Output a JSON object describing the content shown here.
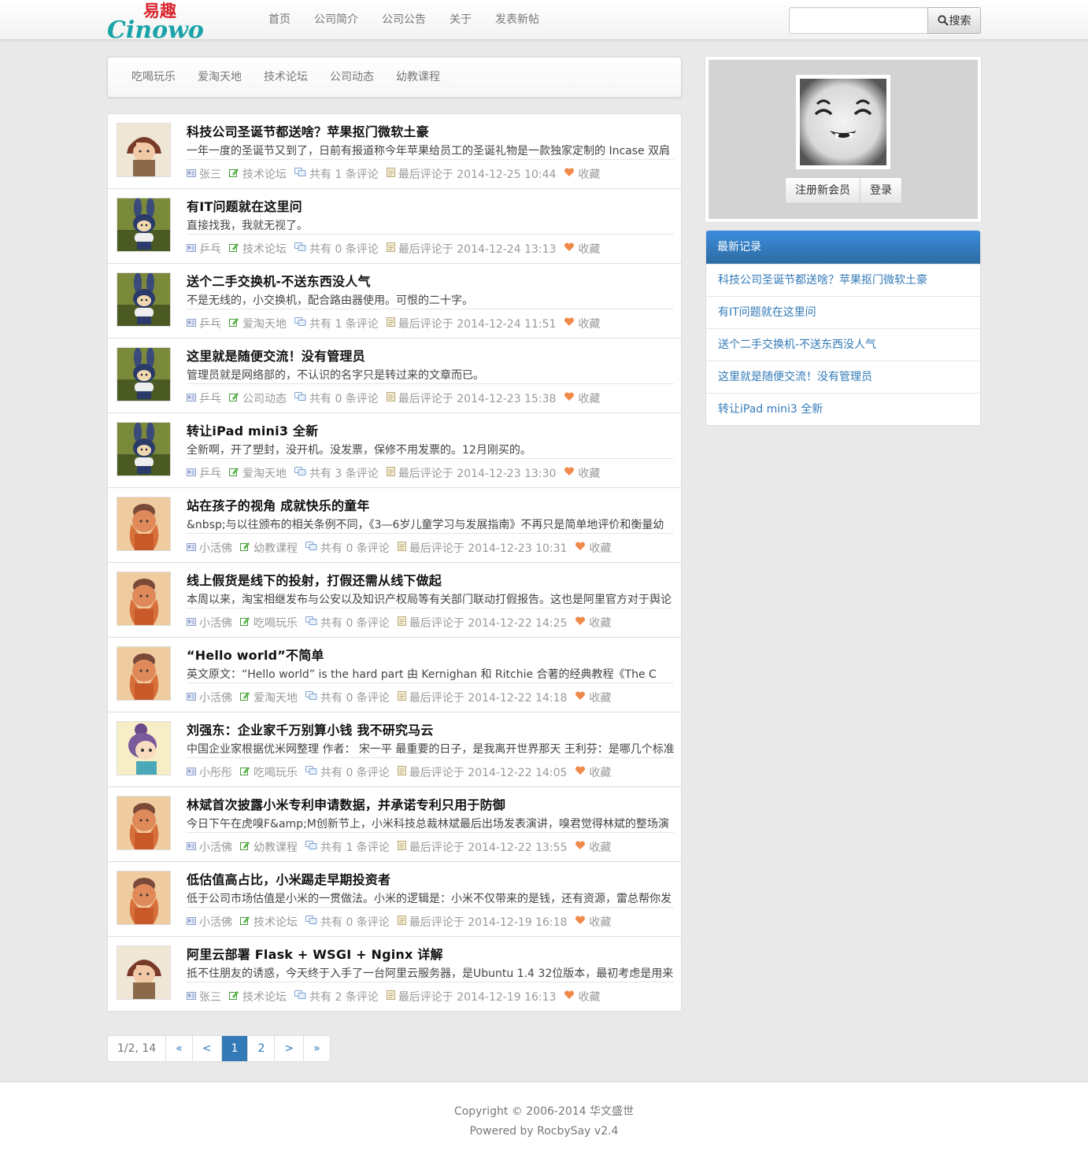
{
  "header": {
    "logo_cn": "易趣",
    "logo_en": "Cinowo",
    "nav": [
      "首页",
      "公司简介",
      "公司公告",
      "关于",
      "发表新帖"
    ],
    "search_label": "搜索"
  },
  "categories": [
    "吃喝玩乐",
    "爱淘天地",
    "技术论坛",
    "公司动态",
    "幼教课程"
  ],
  "posts": [
    {
      "title": "科技公司圣诞节都送啥？苹果抠门微软土豪",
      "excerpt": "一年一度的圣诞节又到了，日前有报道称今年苹果给员工的圣诞礼物是一款独家定制的 Incase 双肩",
      "author": "张三",
      "category": "技术论坛",
      "comments": "共有 1 条评论",
      "last": "最后评论于 2014-12-25 10:44",
      "fav": "收藏",
      "avatar": "girl-hat"
    },
    {
      "title": "有IT问题就在这里问",
      "excerpt": "直接找我，我就无视了。",
      "author": "乒乓",
      "category": "技术论坛",
      "comments": "共有 0 条评论",
      "last": "最后评论于 2014-12-24 13:13",
      "fav": "收藏",
      "avatar": "bunny"
    },
    {
      "title": "送个二手交换机-不送东西没人气",
      "excerpt": "不是无线的，小交换机，配合路由器使用。可恨的二十字。",
      "author": "乒乓",
      "category": "爱淘天地",
      "comments": "共有 1 条评论",
      "last": "最后评论于 2014-12-24 11:51",
      "fav": "收藏",
      "avatar": "bunny"
    },
    {
      "title": "这里就是随便交流！没有管理员",
      "excerpt": "管理员就是网络部的，不认识的名字只是转过来的文章而已。",
      "author": "乒乓",
      "category": "公司动态",
      "comments": "共有 0 条评论",
      "last": "最后评论于 2014-12-23 15:38",
      "fav": "收藏",
      "avatar": "bunny"
    },
    {
      "title": "转让iPad mini3 全新",
      "excerpt": "全新啊，开了塑封，没开机。没发票，保修不用发票的。12月刚买的。",
      "author": "乒乓",
      "category": "爱淘天地",
      "comments": "共有 3 条评论",
      "last": "最后评论于 2014-12-23 13:30",
      "fav": "收藏",
      "avatar": "bunny"
    },
    {
      "title": "站在孩子的视角 成就快乐的童年",
      "excerpt": "&nbsp;与以往颁布的相关条例不同，《3—6岁儿童学习与发展指南》不再只是简单地评价和衡量幼",
      "author": "小活佛",
      "category": "幼教课程",
      "comments": "共有 0 条评论",
      "last": "最后评论于 2014-12-23 10:31",
      "fav": "收藏",
      "avatar": "monk"
    },
    {
      "title": "线上假货是线下的投射，打假还需从线下做起",
      "excerpt": "本周以来，淘宝相继发布与公安以及知识产权局等有关部门联动打假报告。这也是阿里官方对于舆论",
      "author": "小活佛",
      "category": "吃喝玩乐",
      "comments": "共有 0 条评论",
      "last": "最后评论于 2014-12-22 14:25",
      "fav": "收藏",
      "avatar": "monk"
    },
    {
      "title": "“Hello world”不简单",
      "excerpt": "英文原文：“Hello world” is the hard part 由 Kernighan 和 Ritchie 合著的经典教程《The C",
      "author": "小活佛",
      "category": "爱淘天地",
      "comments": "共有 0 条评论",
      "last": "最后评论于 2014-12-22 14:18",
      "fav": "收藏",
      "avatar": "monk"
    },
    {
      "title": "刘强东：企业家千万别算小钱 我不研究马云",
      "excerpt": "中国企业家根据优米网整理 作者： 宋一平 最重要的日子，是我离开世界那天 王利芬：是哪几个标准",
      "author": "小彤彤",
      "category": "吃喝玩乐",
      "comments": "共有 0 条评论",
      "last": "最后评论于 2014-12-22 14:05",
      "fav": "收藏",
      "avatar": "bun-girl"
    },
    {
      "title": "林斌首次披露小米专利申请数据，并承诺专利只用于防御",
      "excerpt": "今日下午在虎嗅F&amp;M创新节上，小米科技总裁林斌最后出场发表演讲，嗅君觉得林斌的整场演",
      "author": "小活佛",
      "category": "幼教课程",
      "comments": "共有 1 条评论",
      "last": "最后评论于 2014-12-22 13:55",
      "fav": "收藏",
      "avatar": "monk"
    },
    {
      "title": "低估值高占比，小米踢走早期投资者",
      "excerpt": "低于公司市场估值是小米的一贯做法。小米的逻辑是：小米不仅带来的是钱，还有资源，雷总帮你发",
      "author": "小活佛",
      "category": "技术论坛",
      "comments": "共有 0 条评论",
      "last": "最后评论于 2014-12-19 16:18",
      "fav": "收藏",
      "avatar": "monk"
    },
    {
      "title": "阿里云部署 Flask + WSGI + Nginx 详解",
      "excerpt": "抵不住朋友的诱惑，今天终于入手了一台阿里云服务器，是Ubuntu 1.4 32位版本，最初考虑是用来",
      "author": "张三",
      "category": "技术论坛",
      "comments": "共有 2 条评论",
      "last": "最后评论于 2014-12-19 16:13",
      "fav": "收藏",
      "avatar": "girl-hat"
    }
  ],
  "pagination": {
    "info": "1/2, 14",
    "first": "«",
    "prev": "<",
    "pages": [
      "1",
      "2"
    ],
    "current": "1",
    "next": ">",
    "last": "»"
  },
  "profile": {
    "register": "注册新会员",
    "login": "登录"
  },
  "recent": {
    "heading": "最新记录",
    "items": [
      "科技公司圣诞节都送啥？苹果抠门微软土豪",
      "有IT问题就在这里问",
      "送个二手交换机-不送东西没人气",
      "这里就是随便交流！没有管理员",
      "转让iPad mini3 全新"
    ]
  },
  "footer": {
    "copyright": "Copyright © 2006-2014 华文盛世",
    "powered": "Powered by RocbySay v2.4"
  },
  "colors": {
    "link": "#337ab7",
    "panel_head": "#337ab7",
    "page_bg": "#e9e9e9"
  }
}
